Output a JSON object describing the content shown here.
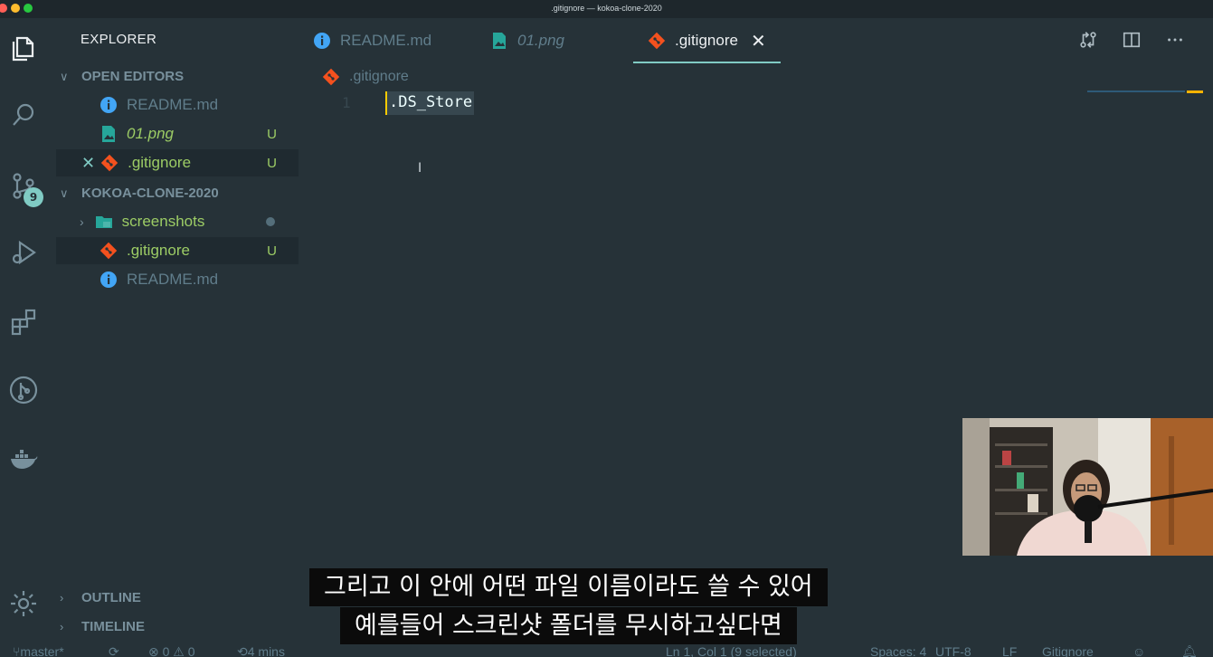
{
  "window": {
    "title": ".gitignore — kokoa-clone-2020"
  },
  "activity_bar": {
    "scm_badge": "9"
  },
  "sidebar": {
    "title": "EXPLORER",
    "open_editors": {
      "label": "OPEN EDITORS",
      "items": [
        {
          "name": "README.md",
          "icon": "info-icon",
          "status": ""
        },
        {
          "name": "01.png",
          "icon": "image-icon",
          "status": "U"
        },
        {
          "name": ".gitignore",
          "icon": "git-icon",
          "status": "U"
        }
      ]
    },
    "project": {
      "label": "KOKOA-CLONE-2020",
      "items": [
        {
          "name": "screenshots",
          "icon": "folder-icon",
          "status": ""
        },
        {
          "name": ".gitignore",
          "icon": "git-icon",
          "status": "U"
        },
        {
          "name": "README.md",
          "icon": "info-icon",
          "status": ""
        }
      ]
    },
    "outline_label": "OUTLINE",
    "timeline_label": "TIMELINE"
  },
  "tabs": [
    {
      "label": "README.md",
      "icon": "info-icon",
      "active": false
    },
    {
      "label": "01.png",
      "icon": "image-icon",
      "active": false
    },
    {
      "label": ".gitignore",
      "icon": "git-icon",
      "active": true
    }
  ],
  "editor": {
    "breadcrumb": ".gitignore",
    "line_number": "1",
    "line_text": ".DS_Store"
  },
  "subtitles": {
    "line1": "그리고 이 안에 어떤 파일 이름이라도 쓸 수 있어",
    "line2": "예를들어 스크린샷 폴더를 무시하고싶다면"
  },
  "statusbar": {
    "branch": "master*",
    "problems": "⊗ 0 ⚠ 0",
    "history": "4 mins",
    "position": "Ln 1, Col 1 (9 selected)",
    "spaces": "Spaces: 4",
    "encoding": "UTF-8",
    "eol": "LF",
    "language": "Gitignore"
  },
  "colors": {
    "background": "#263238",
    "accent": "#80cbc4",
    "untracked": "#9ccc65",
    "git": "#f4511e",
    "info": "#42a5f5"
  }
}
